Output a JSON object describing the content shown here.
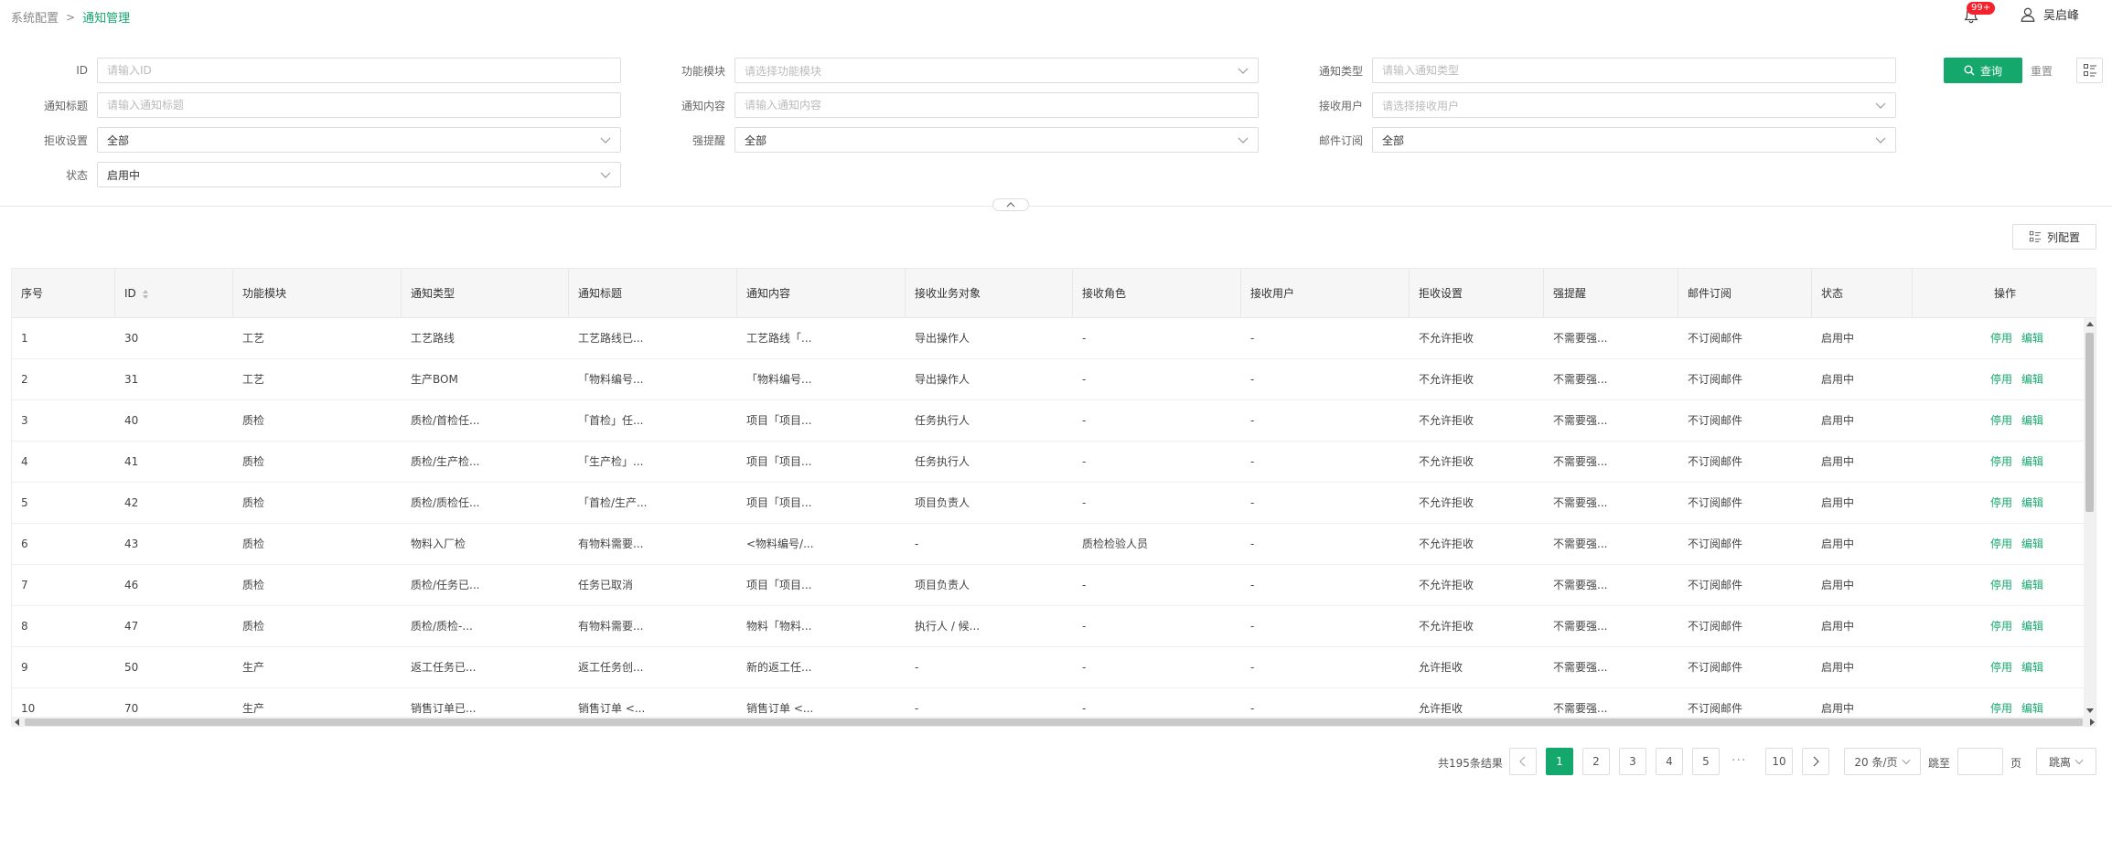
{
  "breadcrumb": {
    "parent": "系统配置",
    "separator": ">",
    "current": "通知管理"
  },
  "header": {
    "notice_badge": "99+",
    "user_name": "吴启峰"
  },
  "colors": {
    "primary": "#14a86d",
    "badge": "#f5222d"
  },
  "filters": {
    "id": {
      "label": "ID",
      "placeholder": "请输入ID"
    },
    "module": {
      "label": "功能模块",
      "placeholder": "请选择功能模块"
    },
    "type": {
      "label": "通知类型",
      "placeholder": "请输入通知类型"
    },
    "title": {
      "label": "通知标题",
      "placeholder": "请输入通知标题"
    },
    "content": {
      "label": "通知内容",
      "placeholder": "请输入通知内容"
    },
    "receiver": {
      "label": "接收用户",
      "placeholder": "请选择接收用户"
    },
    "reject": {
      "label": "拒收设置",
      "value": "全部"
    },
    "strong": {
      "label": "强提醒",
      "value": "全部"
    },
    "mail": {
      "label": "邮件订阅",
      "value": "全部"
    },
    "status": {
      "label": "状态",
      "value": "启用中"
    }
  },
  "actions": {
    "query": "查询",
    "reset": "重置",
    "column_config": "列配置"
  },
  "table": {
    "headers": [
      "序号",
      "ID",
      "功能模块",
      "通知类型",
      "通知标题",
      "通知内容",
      "接收业务对象",
      "接收角色",
      "接收用户",
      "拒收设置",
      "强提醒",
      "邮件订阅",
      "状态",
      "操作"
    ],
    "row_actions": {
      "disable": "停用",
      "edit": "编辑"
    },
    "rows": [
      [
        "1",
        "30",
        "工艺",
        "工艺路线",
        "工艺路线已...",
        "工艺路线「...",
        "导出操作人",
        "-",
        "-",
        "不允许拒收",
        "不需要强...",
        "不订阅邮件",
        "启用中"
      ],
      [
        "2",
        "31",
        "工艺",
        "生产BOM",
        "「物料编号...",
        "「物料编号...",
        "导出操作人",
        "-",
        "-",
        "不允许拒收",
        "不需要强...",
        "不订阅邮件",
        "启用中"
      ],
      [
        "3",
        "40",
        "质检",
        "质检/首检任...",
        "「首检」任...",
        "项目「项目...",
        "任务执行人",
        "-",
        "-",
        "不允许拒收",
        "不需要强...",
        "不订阅邮件",
        "启用中"
      ],
      [
        "4",
        "41",
        "质检",
        "质检/生产检...",
        "「生产检」...",
        "项目「项目...",
        "任务执行人",
        "-",
        "-",
        "不允许拒收",
        "不需要强...",
        "不订阅邮件",
        "启用中"
      ],
      [
        "5",
        "42",
        "质检",
        "质检/质检任...",
        "「首检/生产...",
        "项目「项目...",
        "项目负责人",
        "-",
        "-",
        "不允许拒收",
        "不需要强...",
        "不订阅邮件",
        "启用中"
      ],
      [
        "6",
        "43",
        "质检",
        "物料入厂检",
        "有物料需要...",
        "<物料编号/...",
        "-",
        "质检检验人员",
        "-",
        "不允许拒收",
        "不需要强...",
        "不订阅邮件",
        "启用中"
      ],
      [
        "7",
        "46",
        "质检",
        "质检/任务已...",
        "任务已取消",
        "项目「项目...",
        "项目负责人",
        "-",
        "-",
        "不允许拒收",
        "不需要强...",
        "不订阅邮件",
        "启用中"
      ],
      [
        "8",
        "47",
        "质检",
        "质检/质检-...",
        "有物料需要...",
        "物料「物料...",
        "执行人 / 候...",
        "-",
        "-",
        "不允许拒收",
        "不需要强...",
        "不订阅邮件",
        "启用中"
      ],
      [
        "9",
        "50",
        "生产",
        "返工任务已...",
        "返工任务创...",
        "新的返工任...",
        "-",
        "-",
        "-",
        "允许拒收",
        "不需要强...",
        "不订阅邮件",
        "启用中"
      ],
      [
        "10",
        "70",
        "生产",
        "销售订单已...",
        "销售订单 <...",
        "销售订单 <...",
        "-",
        "-",
        "-",
        "允许拒收",
        "不需要强...",
        "不订阅邮件",
        "启用中"
      ]
    ]
  },
  "pagination": {
    "total_text": "共195条结果",
    "pages": [
      "1",
      "2",
      "3",
      "4",
      "5"
    ],
    "ellipsis": "···",
    "last_page": "10",
    "current": "1",
    "page_size": "20 条/页",
    "jump_label": "跳至",
    "page_label": "页",
    "direction": "跳离"
  }
}
